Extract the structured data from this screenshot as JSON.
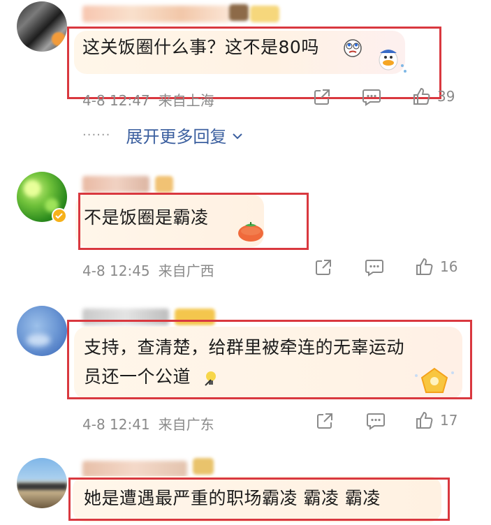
{
  "comments": [
    {
      "text_lines": [
        "这关饭圈什么事？这不是80吗"
      ],
      "time": "4-8 12:47",
      "location": "来自上海",
      "likes": "39",
      "reply_icon": "comment-icon",
      "share_icon": "share-icon",
      "like_icon": "thumbs-up-icon"
    },
    {
      "text_lines": [
        "不是饭圈是霸凌"
      ],
      "time": "4-8 12:45",
      "location": "来自广西",
      "likes": "16"
    },
    {
      "text_lines": [
        "支持，查清楚，给群里被牵连的无辜运动",
        "员还一个公道"
      ],
      "time": "4-8 12:41",
      "location": "来自广东",
      "likes": "17"
    },
    {
      "text_lines": [
        "她是遭遇最严重的职场霸凌 霸凌 霸凌"
      ]
    }
  ],
  "expand_replies": {
    "dots": "······",
    "label": "展开更多回复"
  },
  "colors": {
    "highlight_border": "#d9383f",
    "link_blue": "#3b5f9f",
    "meta_gray": "#8a8a8a"
  }
}
